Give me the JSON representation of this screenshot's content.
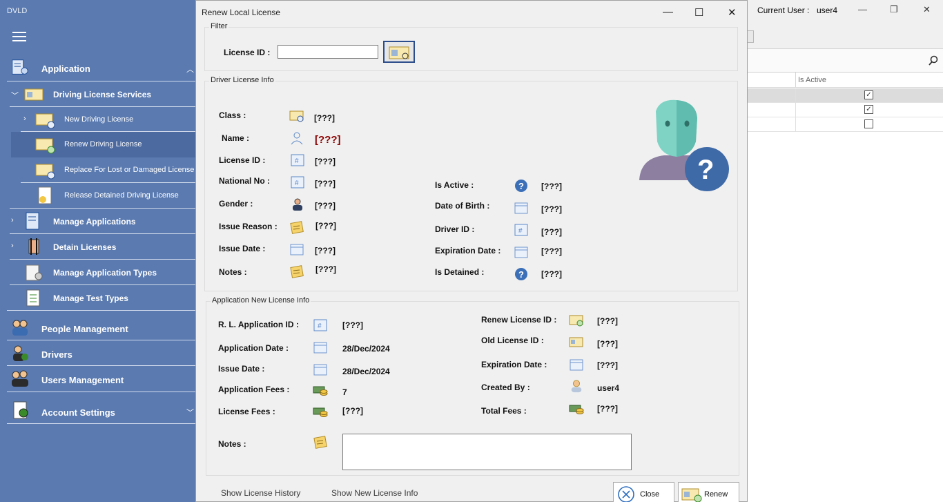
{
  "app": {
    "title": "DVLD"
  },
  "sidebar": {
    "application": "Application",
    "driving_license_services": "Driving License Services",
    "new_driving_license": "New Driving License",
    "renew_driving_license": "Renew Driving License",
    "replace_license": "Replace For Lost or Damaged License",
    "release_detained": "Release Detained Driving License",
    "manage_applications": "Manage Applications",
    "detain_licenses": "Detain Licenses",
    "manage_application_types": "Manage Application Types",
    "manage_test_types": "Manage Test Types",
    "people_management": "People Management",
    "drivers": "Drivers",
    "users_management": "Users Management",
    "account_settings": "Account Settings"
  },
  "main_window": {
    "current_user_label": "Current User :",
    "current_user": "user4",
    "grid_header_is_active": "Is Active",
    "grid_rows_checked": [
      "✓",
      "✓",
      ""
    ]
  },
  "dialog": {
    "title": "Renew Local License",
    "filter": {
      "group_title": "Filter",
      "license_id_label": "License ID :",
      "license_id_value": ""
    },
    "driver_info": {
      "group_title": "Driver License Info",
      "class_label": "Class :",
      "class_value": "[???]",
      "name_label": "Name :",
      "name_value": "[???]",
      "license_id_label": "License ID :",
      "license_id_value": "[???]",
      "national_no_label": "National No :",
      "national_no_value": "[???]",
      "gender_label": "Gender :",
      "gender_value": "[???]",
      "issue_reason_label": "Issue Reason :",
      "issue_reason_value": "[???]",
      "issue_date_label": "Issue Date :",
      "issue_date_value": "[???]",
      "notes_label": "Notes :",
      "notes_value": "[???]",
      "is_active_label": "Is Active :",
      "is_active_value": "[???]",
      "dob_label": "Date of Birth :",
      "dob_value": "[???]",
      "driver_id_label": "Driver ID :",
      "driver_id_value": "[???]",
      "expiration_label": "Expiration Date :",
      "expiration_value": "[???]",
      "is_detained_label": "Is Detained :",
      "is_detained_value": "[???]"
    },
    "application_info": {
      "group_title": "Application New License Info",
      "rl_app_id_label": "R. L. Application ID :",
      "rl_app_id_value": "[???]",
      "app_date_label": "Application Date :",
      "app_date_value": "28/Dec/2024",
      "issue_date_label": "Issue Date :",
      "issue_date_value": "28/Dec/2024",
      "app_fees_label": "Application Fees :",
      "app_fees_value": "7",
      "license_fees_label": "License Fees :",
      "license_fees_value": "[???]",
      "renew_license_id_label": "Renew License ID :",
      "renew_license_id_value": "[???]",
      "old_license_id_label": "Old License ID :",
      "old_license_id_value": "[???]",
      "expiration_label": "Expiration Date :",
      "expiration_value": "[???]",
      "created_by_label": "Created By :",
      "created_by_value": "user4",
      "total_fees_label": "Total Fees :",
      "total_fees_value": "[???]",
      "notes_label": "Notes :",
      "notes_value": ""
    },
    "footer": {
      "show_history": "Show License History",
      "show_new_info": "Show New License Info",
      "close": "Close",
      "renew": "Renew"
    }
  }
}
